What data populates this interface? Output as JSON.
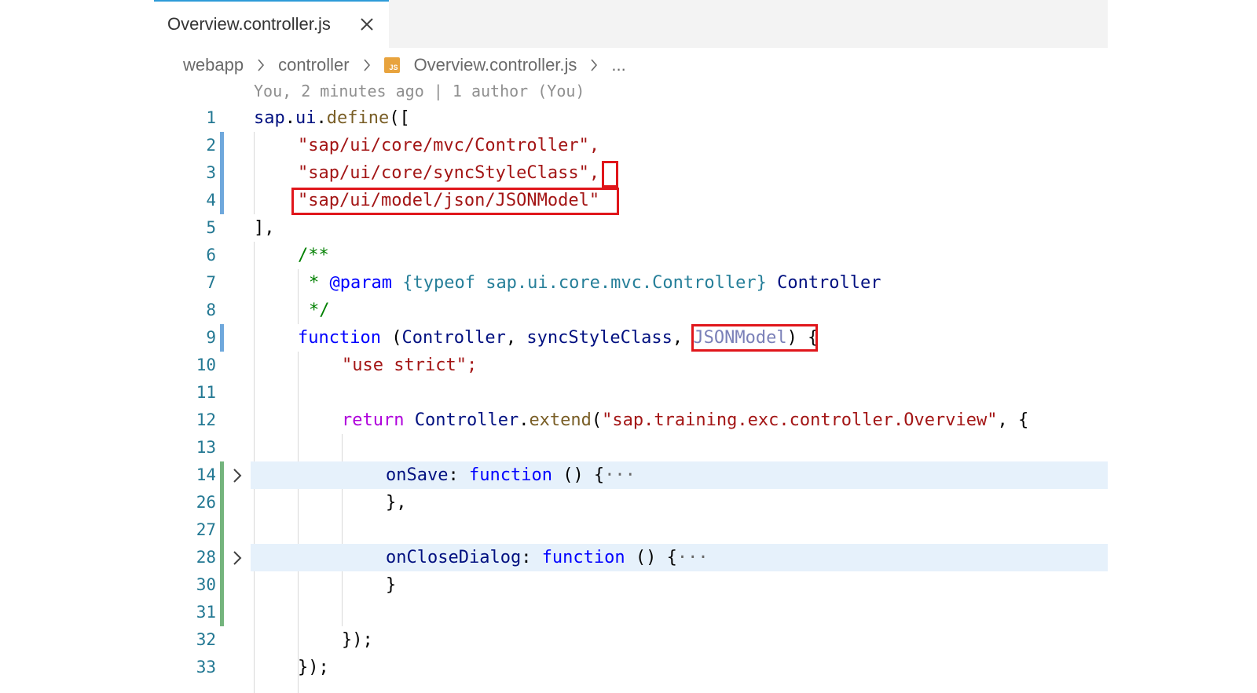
{
  "tab": {
    "label": "Overview.controller.js",
    "close_icon": "close-icon"
  },
  "breadcrumb": {
    "items": [
      "webapp",
      "controller",
      "Overview.controller.js",
      "..."
    ],
    "file_icon_text": "JS"
  },
  "blame": "You, 2 minutes ago | 1 author (You)",
  "colors": {
    "accent": "#2d9bd8",
    "highlight_box": "#e0161b",
    "line_number": "#237893",
    "git_modified": "#6fa8dc",
    "git_added": "#74b47d"
  },
  "lines": [
    {
      "no": "1",
      "text": "sap.ui.define(["
    },
    {
      "no": "2",
      "text": "\"sap/ui/core/mvc/Controller\","
    },
    {
      "no": "3",
      "text": "\"sap/ui/core/syncStyleClass\","
    },
    {
      "no": "4",
      "text": "\"sap/ui/model/json/JSONModel\""
    },
    {
      "no": "5",
      "text": "],"
    },
    {
      "no": "6",
      "text": "/**"
    },
    {
      "no": "7",
      "text": "* @param {typeof sap.ui.core.mvc.Controller} Controller"
    },
    {
      "no": "8",
      "text": "*/"
    },
    {
      "no": "9",
      "text": "function (Controller, syncStyleClass, JSONModel) {"
    },
    {
      "no": "10",
      "text": "\"use strict\";"
    },
    {
      "no": "11",
      "text": ""
    },
    {
      "no": "12",
      "text": "return Controller.extend(\"sap.training.exc.controller.Overview\", {"
    },
    {
      "no": "13",
      "text": ""
    },
    {
      "no": "14",
      "text": "onSave: function () {···"
    },
    {
      "no": "26",
      "text": "},"
    },
    {
      "no": "27",
      "text": ""
    },
    {
      "no": "28",
      "text": "onCloseDialog: function () {···"
    },
    {
      "no": "30",
      "text": "}"
    },
    {
      "no": "31",
      "text": ""
    },
    {
      "no": "32",
      "text": "});"
    },
    {
      "no": "33",
      "text": "});"
    }
  ]
}
